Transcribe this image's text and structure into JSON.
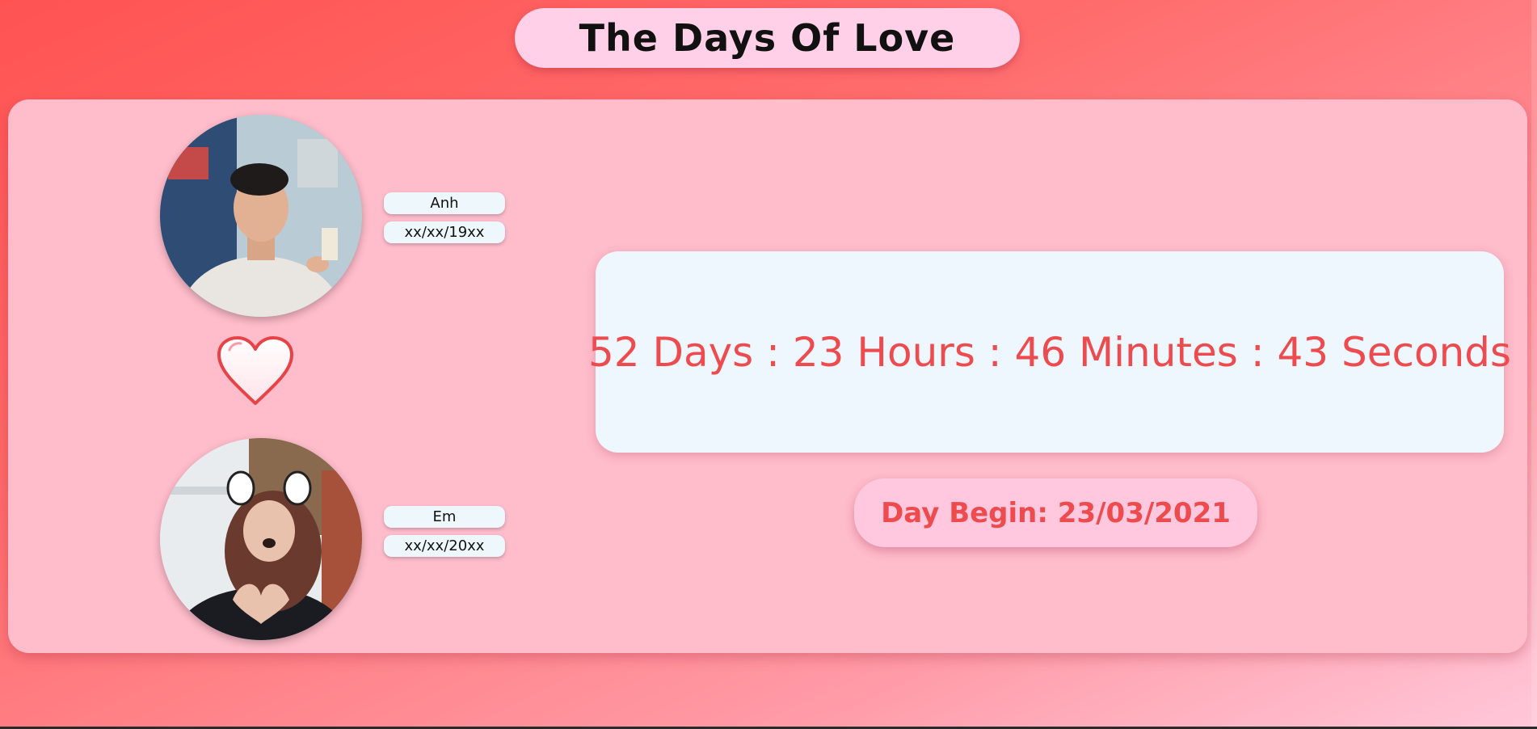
{
  "title": "The Days Of Love",
  "person_one": {
    "name": "Anh",
    "birthday": "xx/xx/19xx"
  },
  "person_two": {
    "name": "Em",
    "birthday": "xx/xx/20xx"
  },
  "counter": {
    "text": "52 Days : 23 Hours : 46 Minutes : 43 Seconds"
  },
  "day_begin": {
    "text": "Day Begin: 23/03/2021"
  },
  "icons": {
    "heart": "heart-icon"
  },
  "colors": {
    "accent": "#ee4b4f",
    "card": "#ffbccb",
    "title_pill": "#ffd0e8",
    "counter_box": "#eef7fd"
  }
}
